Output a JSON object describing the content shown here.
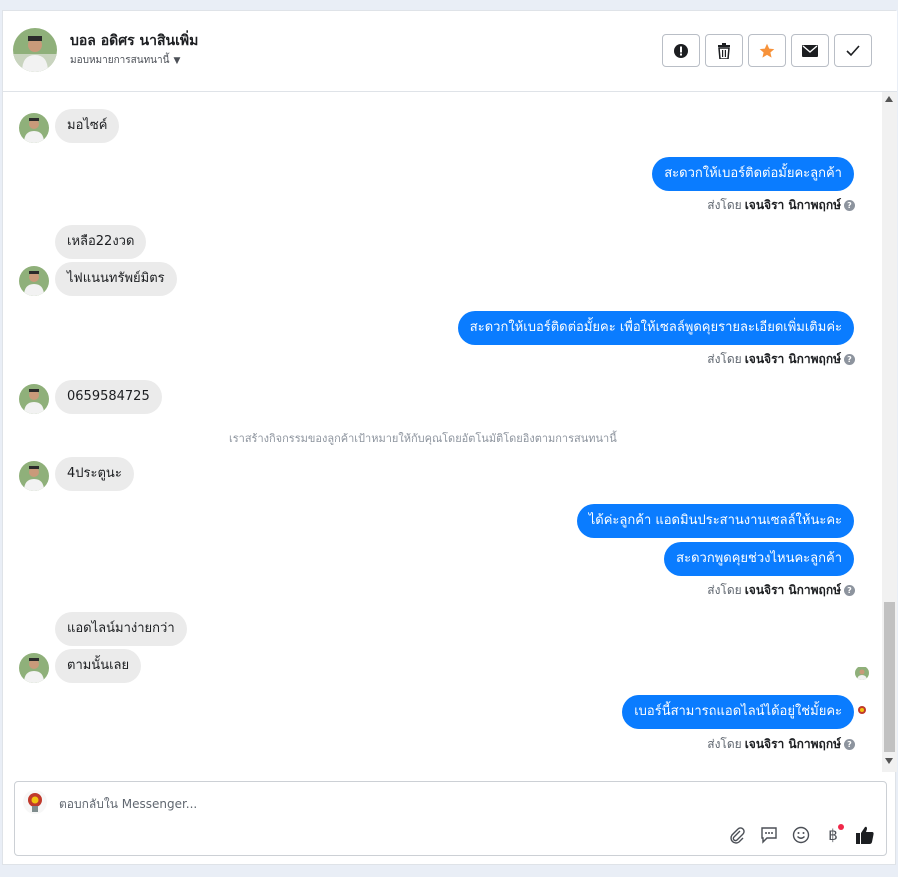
{
  "header": {
    "name": "บอล อดิศร นาสินเพิ่ม",
    "assign_label": "มอบหมายการสนทนานี้",
    "actions": [
      {
        "icon": "alert-icon",
        "label": ""
      },
      {
        "icon": "trash-icon",
        "label": ""
      },
      {
        "icon": "star-icon",
        "label": ""
      },
      {
        "icon": "mail-icon",
        "label": ""
      },
      {
        "icon": "check-icon",
        "label": ""
      }
    ]
  },
  "colors": {
    "outgoing_bubble": "#0a7cff",
    "incoming_bubble": "#ebebeb",
    "star": "#f7923a"
  },
  "messages": {
    "in_1": "มอไซค์",
    "out_1": "สะดวกให้เบอร์ติดต่อมั้ยคะลูกค้า",
    "sentby_1_prefix": "ส่งโดย",
    "sentby_1_name": "เจนจิรา นิกาพฤกษ์",
    "in_2": "เหลือ22งวด",
    "in_3": "ไฟแนนทรัพย์มิตร",
    "out_2": "สะดวกให้เบอร์ติดต่อมั้ยคะ เพื่อให้เซลล์พูดคุยรายละเอียดเพิ่มเติมค่ะ",
    "sentby_2_prefix": "ส่งโดย",
    "sentby_2_name": "เจนจิรา นิกาพฤกษ์",
    "in_4": "0659584725",
    "system_note": "เราสร้างกิจกรรมของลูกค้าเป้าหมายให้กับคุณโดยอัตโนมัติโดยอิงตามการสนทนานี้",
    "in_5": "4ประตูนะ",
    "out_3": "ได้ค่ะลูกค้า แอดมินประสานงานเซลล์ให้นะคะ",
    "out_4": "สะดวกพูดคุยช่วงไหนคะลูกค้า",
    "sentby_3_prefix": "ส่งโดย",
    "sentby_3_name": "เจนจิรา นิกาพฤกษ์",
    "in_6": "แอดไลน์มาง่ายกว่า",
    "in_7": "ตามนั้นเลย",
    "out_5": "เบอร์นี้สามารถแอดไลน์ได้อยู่ใช่มั้ยคะ",
    "sentby_4_prefix": "ส่งโดย",
    "sentby_4_name": "เจนจิรา นิกาพฤกษ์"
  },
  "reply": {
    "placeholder": "ตอบกลับใน Messenger...",
    "tools": [
      "attachment-icon",
      "saved-reply-icon",
      "emoji-icon",
      "baht-icon",
      "like-icon"
    ],
    "baht_symbol": "฿"
  }
}
